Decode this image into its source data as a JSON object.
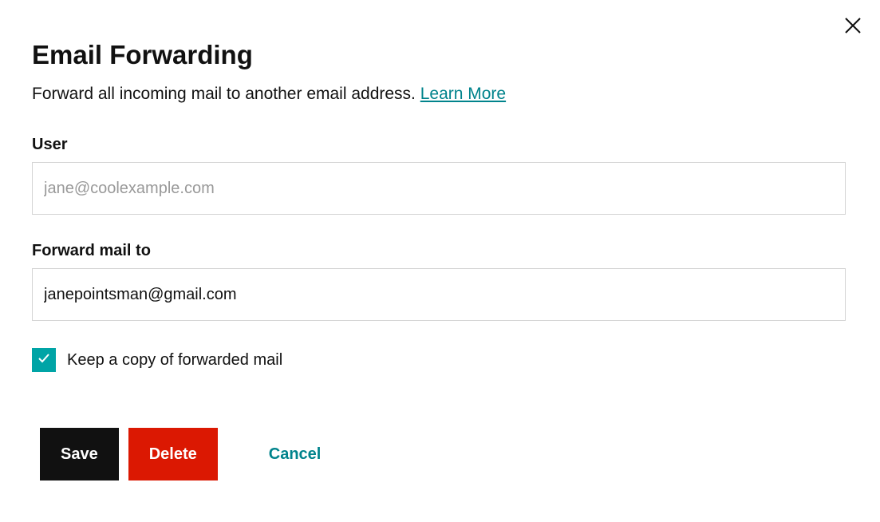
{
  "dialog": {
    "title": "Email Forwarding",
    "description_prefix": "Forward all incoming mail to another email address. ",
    "learn_more": "Learn More"
  },
  "fields": {
    "user": {
      "label": "User",
      "value": "jane@coolexample.com"
    },
    "forward_to": {
      "label": "Forward mail to",
      "value": "janepointsman@gmail.com"
    }
  },
  "checkbox": {
    "label": "Keep a copy of forwarded mail",
    "checked": true
  },
  "buttons": {
    "save": "Save",
    "delete": "Delete",
    "cancel": "Cancel"
  },
  "colors": {
    "teal": "#00838C",
    "checkbox_bg": "#00A4A6",
    "delete_bg": "#DB1802",
    "save_bg": "#111111"
  }
}
